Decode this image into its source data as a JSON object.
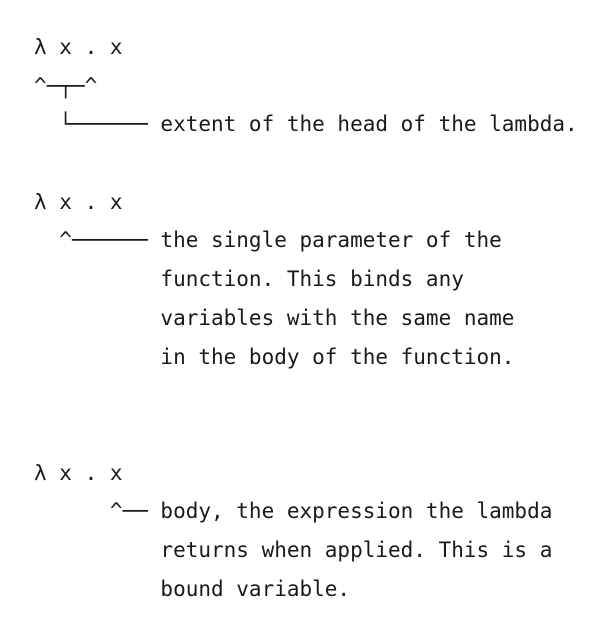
{
  "lines": [
    "λ x . x",
    "^─┬─^",
    "  └────── extent of the head of the lambda.",
    "",
    "λ x . x",
    "  ^────── the single parameter of the",
    "          function. This binds any",
    "          variables with the same name",
    "          in the body of the function.",
    "",
    "",
    "λ x . x",
    "      ^── body, the expression the lambda",
    "          returns when applied. This is a",
    "          bound variable."
  ]
}
